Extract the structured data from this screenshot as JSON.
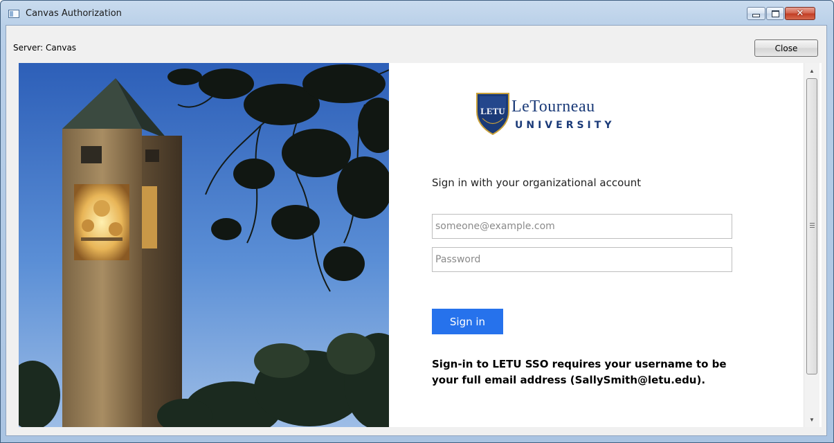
{
  "window": {
    "title": "Canvas Authorization",
    "close_glyph": "✕"
  },
  "toolbar": {
    "server_label": "Server: Canvas",
    "close_label": "Close"
  },
  "logo": {
    "shield_text": "LETU",
    "name": "LeTourneau",
    "subtitle": "UNIVERSITY"
  },
  "form": {
    "heading": "Sign in with your organizational account",
    "email_placeholder": "someone@example.com",
    "password_placeholder": "Password",
    "signin_label": "Sign in",
    "notice": "Sign-in to LETU SSO requires your username to be your full email address (SallySmith@letu.edu)."
  },
  "colors": {
    "signin_button": "#2672ec",
    "logo_blue": "#1a3a78",
    "logo_gold": "#c9a13a"
  },
  "icons": {
    "app": "application-window-icon",
    "scroll_up": "scroll-up-arrow-icon",
    "scroll_down": "scroll-down-arrow-icon"
  }
}
